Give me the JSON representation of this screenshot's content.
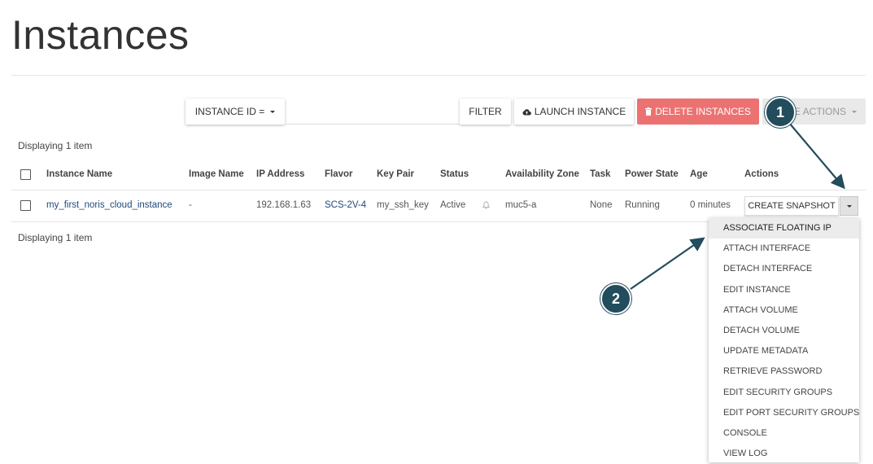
{
  "page": {
    "title": "Instances"
  },
  "toolbar": {
    "filter_key_label": "INSTANCE ID =",
    "filter_button": "FILTER",
    "launch_button": "LAUNCH INSTANCE",
    "delete_button": "DELETE INSTANCES",
    "more_actions_button": "MORE ACTIONS",
    "delete_color": "#ec7272"
  },
  "table": {
    "count_text": "Displaying 1 item",
    "headers": [
      "Instance Name",
      "Image Name",
      "IP Address",
      "Flavor",
      "Key Pair",
      "Status",
      "Availability Zone",
      "Task",
      "Power State",
      "Age",
      "Actions"
    ],
    "rows": [
      {
        "instance_name": "my_first_noris_cloud_instance",
        "image_name": "-",
        "ip_address": "192.168.1.63",
        "flavor": "SCS-2V-4",
        "key_pair": "my_ssh_key",
        "status": "Active",
        "availability_zone": "muc5-a",
        "task": "None",
        "power_state": "Running",
        "age": "0 minutes",
        "primary_action": "CREATE SNAPSHOT"
      }
    ]
  },
  "actions_menu": {
    "items": [
      "ASSOCIATE FLOATING IP",
      "ATTACH INTERFACE",
      "DETACH INTERFACE",
      "EDIT INSTANCE",
      "ATTACH VOLUME",
      "DETACH VOLUME",
      "UPDATE METADATA",
      "RETRIEVE PASSWORD",
      "EDIT SECURITY GROUPS",
      "EDIT PORT SECURITY GROUPS",
      "CONSOLE",
      "VIEW LOG"
    ],
    "highlighted_index": 0
  },
  "annotations": {
    "badge_1": "1",
    "badge_2": "2",
    "color": "#234c5c"
  },
  "icons": [
    "cloud-upload-icon",
    "trash-icon",
    "bell-icon",
    "caret-down-icon"
  ]
}
